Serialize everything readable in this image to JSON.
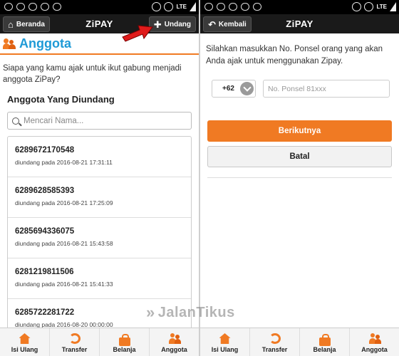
{
  "left": {
    "appbar": {
      "title": "ZiPAY",
      "back_label": "Beranda",
      "invite_label": "Undang"
    },
    "page_title": "Anggota",
    "intro": "Siapa yang kamu ajak untuk ikut gabung menjadi anggota ZiPay?",
    "section_title": "Anggota Yang Diundang",
    "search": {
      "placeholder": "Mencari Nama..."
    },
    "members": [
      {
        "phone": "6289672170548",
        "invited": "diundang pada 2016-08-21 17:31:11"
      },
      {
        "phone": "6289628585393",
        "invited": "diundang pada 2016-08-21 17:25:09"
      },
      {
        "phone": "6285694336075",
        "invited": "diundang pada 2016-08-21 15:43:58"
      },
      {
        "phone": "6281219811506",
        "invited": "diundang pada 2016-08-21 15:41:33"
      },
      {
        "phone": "6285722281722",
        "invited": "diundang pada 2016-08-20 00:00:00"
      }
    ],
    "tabs": [
      "Isi Ulang",
      "Transfer",
      "Belanja",
      "Anggota"
    ]
  },
  "right": {
    "appbar": {
      "title": "ZiPAY",
      "back_label": "Kembali"
    },
    "instruction": "Silahkan masukkan No. Ponsel orang yang akan Anda ajak untuk menggunakan Zipay.",
    "country_code": "+62",
    "phone_placeholder": "No. Ponsel 81xxx",
    "next_label": "Berikutnya",
    "cancel_label": "Batal",
    "tabs": [
      "Isi Ulang",
      "Transfer",
      "Belanja",
      "Anggota"
    ]
  },
  "watermark": "JalanTikus",
  "colors": {
    "accent": "#f07a23",
    "title_blue": "#1e9ad6",
    "appbar": "#1a1a1a"
  }
}
